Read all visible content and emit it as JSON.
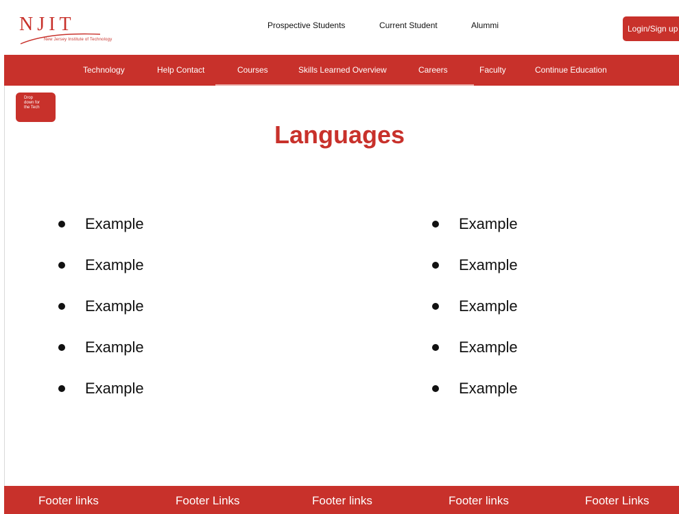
{
  "header": {
    "logo": {
      "letters": "NJIT",
      "tagline": "New Jersey Institute of Technology"
    },
    "links": [
      "Prospective Students",
      "Current Student",
      "Alummi"
    ],
    "login_label": "Login/Sign up"
  },
  "nav": {
    "items": [
      "Technology",
      "Help Contact",
      "Courses",
      "Skills Learned Overview",
      "Careers",
      "Faculty",
      "Continue Education"
    ]
  },
  "dropdown": {
    "lines": [
      "Drop",
      "down for",
      "the Tech"
    ]
  },
  "main": {
    "title": "Languages",
    "left_items": [
      "Example",
      "Example",
      "Example",
      "Example",
      "Example"
    ],
    "right_items": [
      "Example",
      "Example",
      "Example",
      "Example",
      "Example"
    ]
  },
  "footer": {
    "links": [
      "Footer links",
      "Footer Links",
      "Footer links",
      "Footer links",
      "Footer Links"
    ]
  },
  "theme": {
    "accent": "#c8312b",
    "text": "#111111",
    "background": "#ffffff"
  }
}
